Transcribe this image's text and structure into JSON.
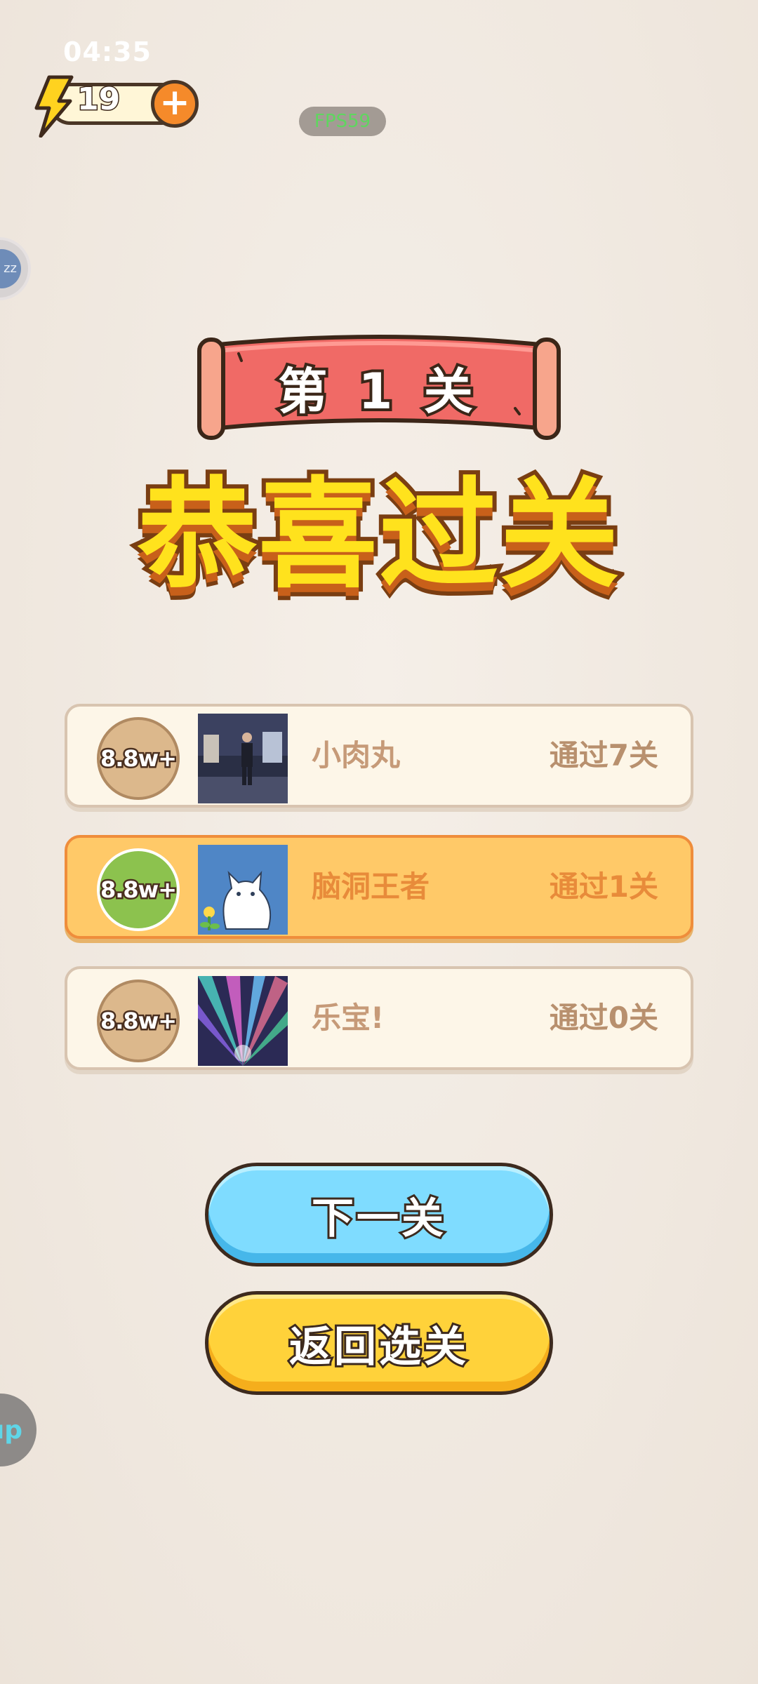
{
  "status_bar": {
    "time": "04:35"
  },
  "hud": {
    "energy_count": "19",
    "add_label": "+",
    "fps": "FPS59"
  },
  "side": {
    "top_float_label": "zz",
    "bottom_float_label": "up"
  },
  "level": {
    "banner": "第 1 关",
    "congrats": "恭喜过关"
  },
  "ranking": [
    {
      "badge": "8.8w+",
      "name": "小肉丸",
      "passed": "通过7关",
      "highlight": false
    },
    {
      "badge": "8.8w+",
      "name": "脑洞王者",
      "passed": "通过1关",
      "highlight": true
    },
    {
      "badge": "8.8w+",
      "name": "乐宝!",
      "passed": "通过0关",
      "highlight": false
    }
  ],
  "buttons": {
    "next": "下一关",
    "back": "返回选关"
  },
  "colors": {
    "background": "#f2ebe3",
    "banner_red": "#f06a66",
    "congrats_yellow": "#ffe21d",
    "highlight_row": "#ffc968",
    "next_button": "#7fdcff",
    "back_button": "#ffd23a"
  }
}
